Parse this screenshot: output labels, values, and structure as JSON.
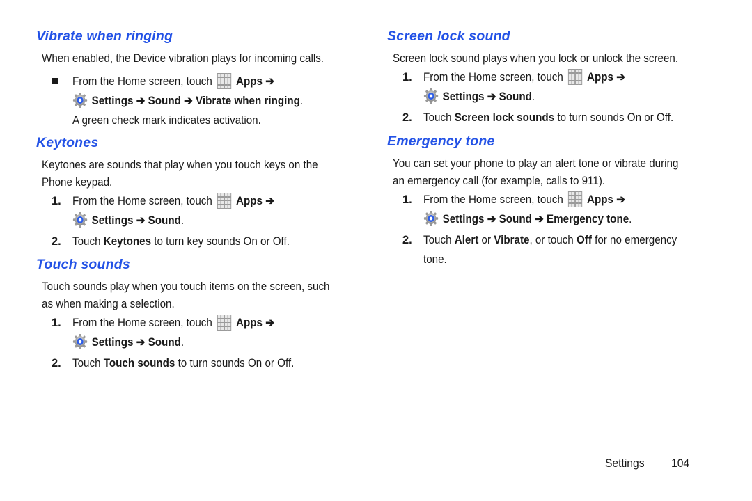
{
  "left_column": {
    "vibrate": {
      "heading": "Vibrate when ringing",
      "description": "When enabled, the Device vibration plays for incoming calls.",
      "step": {
        "prefix": "From the Home screen, touch",
        "apps": "Apps",
        "arrow": "➔",
        "settings": "Settings",
        "sound": "Sound",
        "target": "Vibrate when ringing",
        "note": "A green check mark indicates activation."
      }
    },
    "keytones": {
      "heading": "Keytones",
      "description_line1": "Keytones are sounds that play when you touch keys on the",
      "description_line2": "Phone keypad.",
      "step1": {
        "num": "1.",
        "prefix": "From the Home screen, touch",
        "apps": "Apps",
        "arrow": "➔",
        "settings": "Settings",
        "sound": "Sound"
      },
      "step2": {
        "num": "2.",
        "pre": "Touch",
        "bold": "Keytones",
        "post": "to turn key sounds On or Off."
      }
    },
    "touch_sounds": {
      "heading": "Touch sounds",
      "description_line1": "Touch sounds play when you touch items on the screen, such",
      "description_line2": "as when making a selection.",
      "step1": {
        "num": "1.",
        "prefix": "From the Home screen, touch",
        "apps": "Apps",
        "arrow": "➔",
        "settings": "Settings",
        "sound": "Sound"
      },
      "step2": {
        "num": "2.",
        "pre": "Touch",
        "bold": "Touch sounds",
        "post": "to turn sounds On or Off."
      }
    }
  },
  "right_column": {
    "screen_lock": {
      "heading": "Screen lock sound",
      "description": "Screen lock sound plays when you lock or unlock the screen.",
      "step1": {
        "num": "1.",
        "prefix": "From the Home screen, touch",
        "apps": "Apps",
        "arrow": "➔",
        "settings": "Settings",
        "sound": "Sound"
      },
      "step2": {
        "num": "2.",
        "pre": "Touch",
        "bold": "Screen lock sounds",
        "post": "to turn sounds On or Off."
      }
    },
    "emergency": {
      "heading": "Emergency tone",
      "description_line1": "You can set your phone to play an alert tone or vibrate during",
      "description_line2": "an emergency call (for example, calls to 911).",
      "step1": {
        "num": "1.",
        "prefix": "From the Home screen, touch",
        "apps": "Apps",
        "arrow": "➔",
        "settings": "Settings",
        "sound": "Sound",
        "target": "Emergency tone"
      },
      "step2": {
        "num": "2.",
        "pre": "Touch",
        "alert": "Alert",
        "or": "or",
        "vibrate": "Vibrate",
        "mid": ", or touch",
        "off": "Off",
        "post": "for no emergency",
        "line2": "tone."
      }
    }
  },
  "footer": {
    "section": "Settings",
    "page": "104"
  },
  "colors": {
    "heading": "#2352e6",
    "text": "#1a1a1a"
  }
}
